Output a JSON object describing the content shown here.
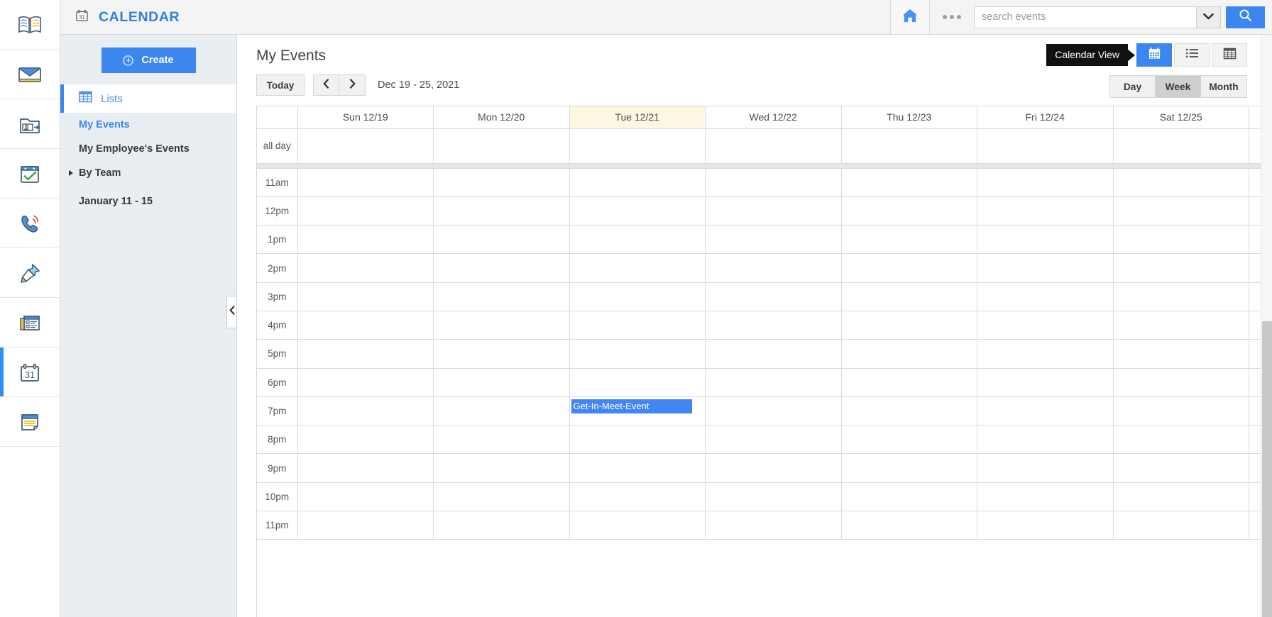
{
  "app": {
    "brand_title": "CALENDAR",
    "brand_icon": "calendar-31-icon"
  },
  "topbar": {
    "home_icon": "home-icon",
    "overflow_icon": "ellipsis-icon",
    "search_placeholder": "search events",
    "search_value": "",
    "search_caret_icon": "chevron-down-icon",
    "search_button_icon": "search-icon"
  },
  "iconrail": {
    "items": [
      {
        "icon": "open-book-icon",
        "active": false
      },
      {
        "icon": "envelope-mail-icon",
        "active": false
      },
      {
        "icon": "contact-folder-icon",
        "active": false
      },
      {
        "icon": "task-checkmark-icon",
        "active": false
      },
      {
        "icon": "phone-ring-icon",
        "active": false
      },
      {
        "icon": "pushpin-icon",
        "active": false
      },
      {
        "icon": "news-article-icon",
        "active": false
      },
      {
        "icon": "calendar-31-icon",
        "active": true
      },
      {
        "icon": "notepad-icon",
        "active": false
      }
    ]
  },
  "sidebar": {
    "create_label": "Create",
    "create_icon": "plus-circle-icon",
    "lists_label": "Lists",
    "lists_icon": "grid-table-icon",
    "items": [
      {
        "label": "My Events",
        "selected": true,
        "expandable": false
      },
      {
        "label": "My Employee's Events",
        "selected": false,
        "expandable": false
      },
      {
        "label": "By Team",
        "selected": false,
        "expandable": true
      },
      {
        "label": "January 11 - 15",
        "selected": false,
        "expandable": false
      }
    ],
    "collapse_icon": "chevron-left-icon"
  },
  "main": {
    "page_title": "My Events",
    "today_label": "Today",
    "prev_icon": "chevron-left-icon",
    "next_icon": "chevron-right-icon",
    "date_range": "Dec 19 - 25, 2021",
    "tooltip_text": "Calendar View",
    "view_buttons": [
      {
        "name": "calendar-view",
        "icon": "calendar-grid-icon",
        "active": true
      },
      {
        "name": "list-view",
        "icon": "list-icon",
        "active": false
      },
      {
        "name": "table-view",
        "icon": "table-icon",
        "active": false
      }
    ],
    "range_buttons": [
      {
        "label": "Day",
        "active": false
      },
      {
        "label": "Week",
        "active": true
      },
      {
        "label": "Month",
        "active": false
      }
    ]
  },
  "calendar": {
    "day_headers": [
      {
        "label": "Sun 12/19",
        "today": false
      },
      {
        "label": "Mon 12/20",
        "today": false
      },
      {
        "label": "Tue 12/21",
        "today": true
      },
      {
        "label": "Wed 12/22",
        "today": false
      },
      {
        "label": "Thu 12/23",
        "today": false
      },
      {
        "label": "Fri 12/24",
        "today": false
      },
      {
        "label": "Sat 12/25",
        "today": false
      }
    ],
    "all_day_label": "all day",
    "time_slots": [
      "11am",
      "12pm",
      "1pm",
      "2pm",
      "3pm",
      "4pm",
      "5pm",
      "6pm",
      "7pm",
      "8pm",
      "9pm",
      "10pm",
      "11pm"
    ],
    "events": [
      {
        "title": "Get-In-Meet-Event",
        "day_index": 2,
        "time_slot": "7pm",
        "color": "#4285f4",
        "text_color": "#ffffff"
      }
    ]
  },
  "colors": {
    "accent_blue": "#3b87ef",
    "event_blue": "#4285f4",
    "today_highlight": "#fdf6e3",
    "sidebar_bg": "#e9eef3",
    "topbar_bg": "#f4f4f4",
    "tooltip_bg": "#111111"
  }
}
